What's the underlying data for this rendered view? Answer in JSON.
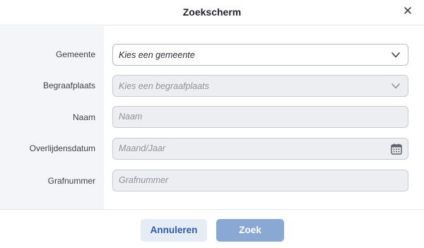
{
  "dialog": {
    "title": "Zoekscherm",
    "close_icon": "close-icon",
    "close_glyph": "✕"
  },
  "form": {
    "fields": [
      {
        "label": "Gemeente",
        "placeholder": "Kies een gemeente",
        "type": "select",
        "state": "enabled",
        "icon": "chevron-down-icon"
      },
      {
        "label": "Begraafplaats",
        "placeholder": "Kies een begraafplaats",
        "type": "select",
        "state": "disabled",
        "icon": "chevron-down-icon"
      },
      {
        "label": "Naam",
        "placeholder": "Naam",
        "type": "text",
        "state": "disabled"
      },
      {
        "label": "Overlijdensdatum",
        "placeholder": "Maand/Jaar",
        "type": "date",
        "state": "disabled",
        "icon": "calendar-icon"
      },
      {
        "label": "Grafnummer",
        "placeholder": "Grafnummer",
        "type": "text",
        "state": "disabled"
      }
    ]
  },
  "footer": {
    "cancel_label": "Annuleren",
    "search_label": "Zoek"
  },
  "colors": {
    "primary": "#2e5aa6",
    "primary_disabled": "#89a8d3",
    "secondary_bg": "#e6ecf6"
  }
}
